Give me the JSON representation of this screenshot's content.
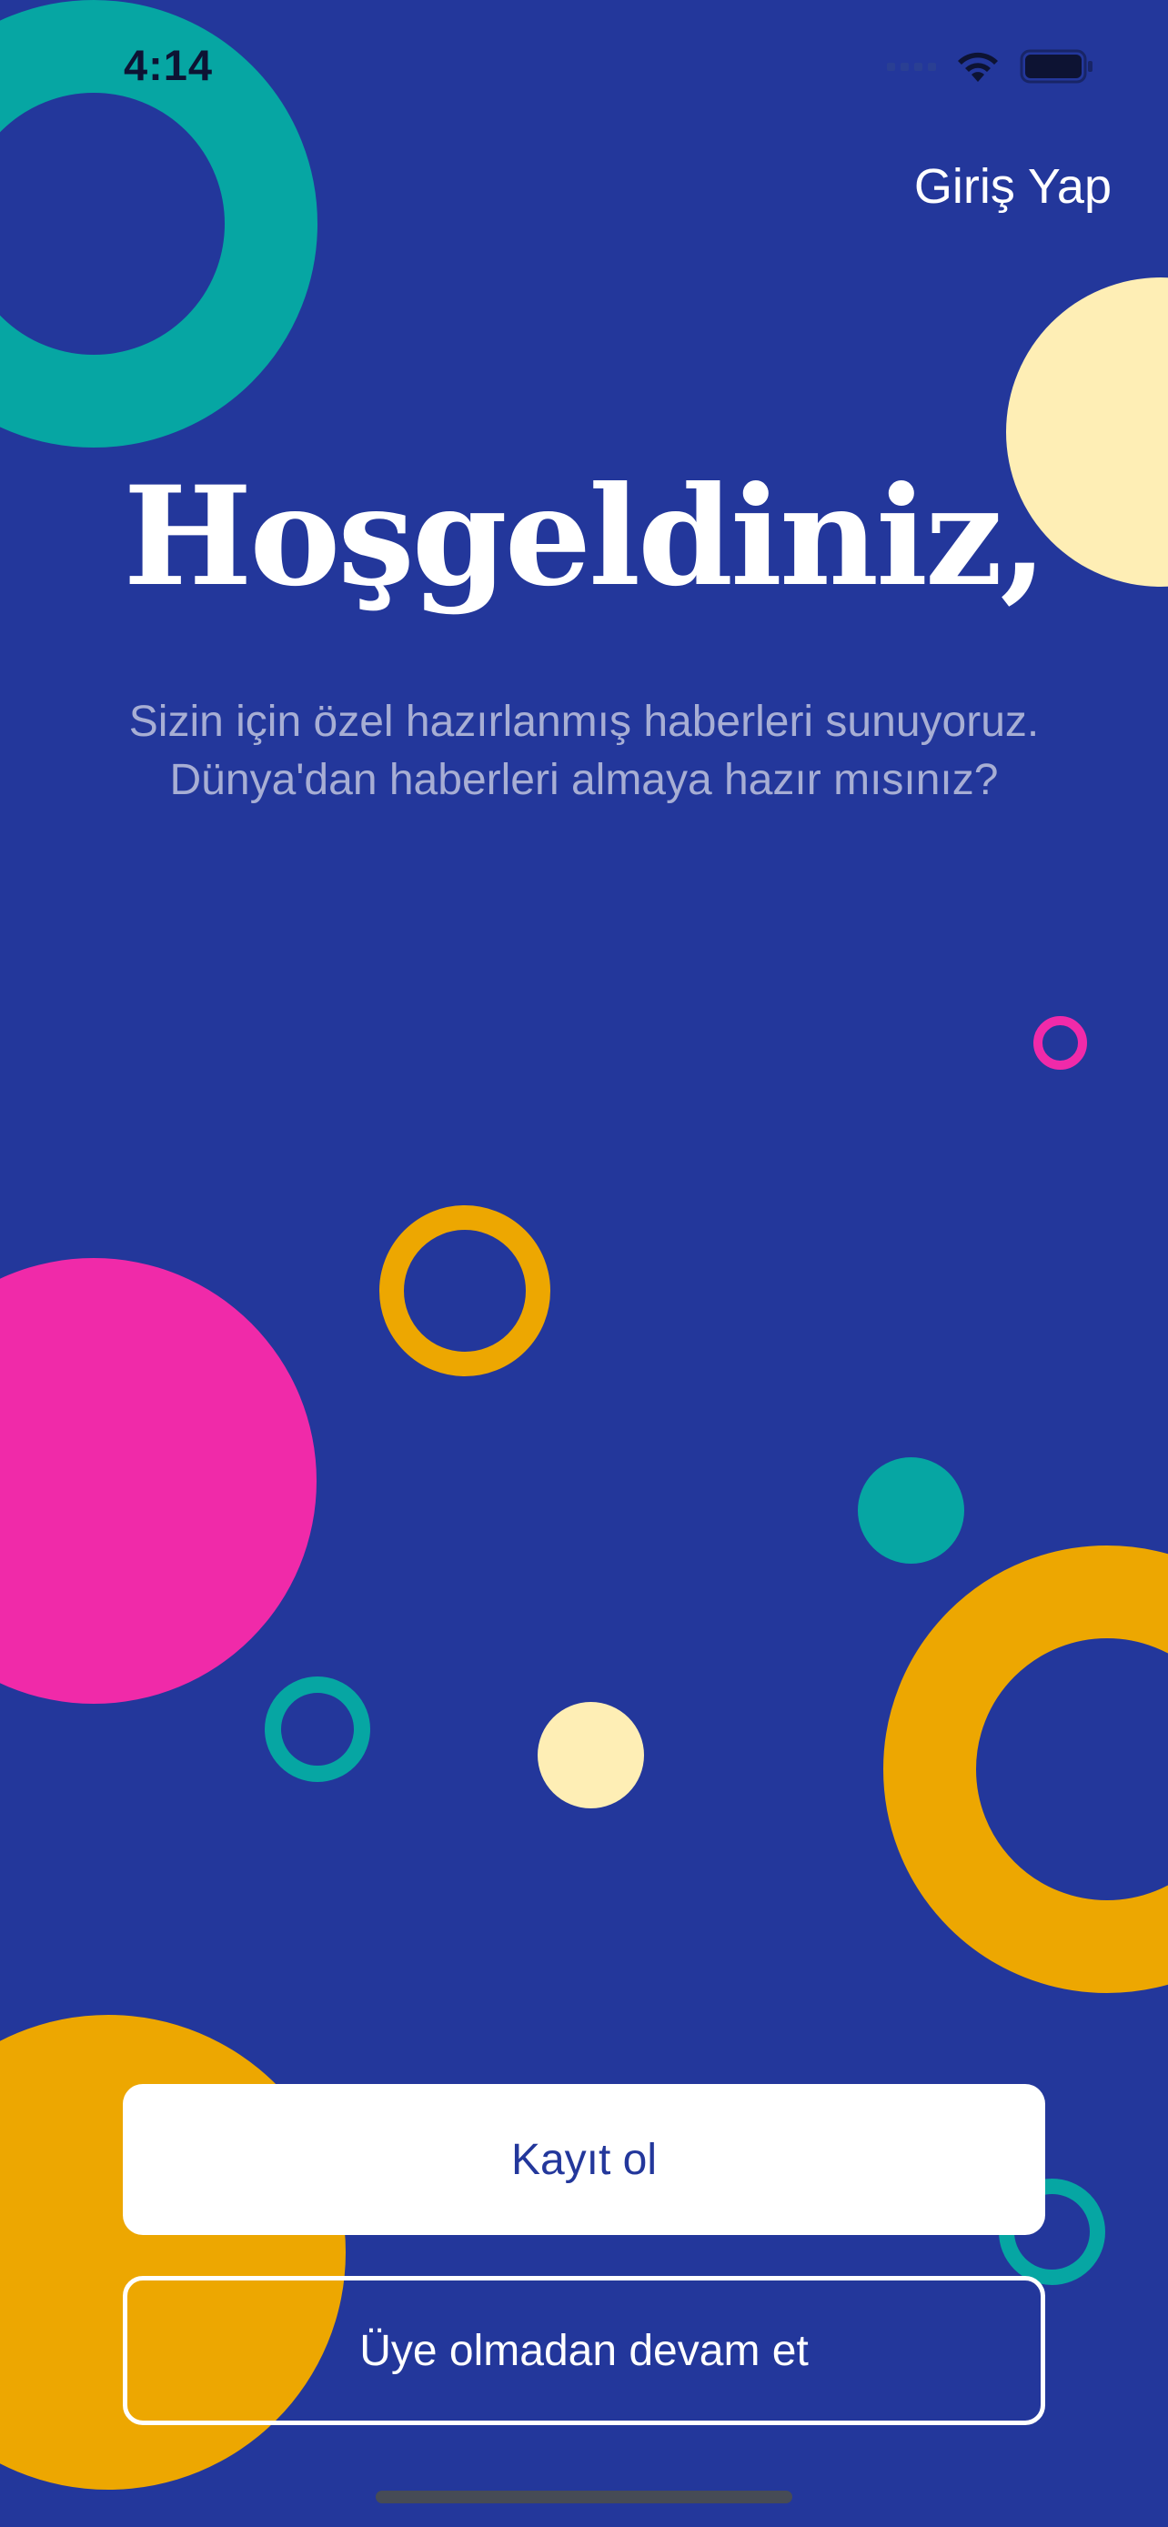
{
  "status_bar": {
    "time": "4:14"
  },
  "header": {
    "login_label": "Giriş Yap"
  },
  "welcome": {
    "title": "Hoşgeldiniz,",
    "subtitle_line1": "Sizin için özel hazırlanmış haberleri sunuyoruz.",
    "subtitle_line2": "Dünya'dan haberleri almaya hazır mısınız?"
  },
  "actions": {
    "register_label": "Kayıt ol",
    "guest_label": "Üye olmadan devam et"
  },
  "colors": {
    "background": "#23379b",
    "teal": "#06a6a3",
    "cream": "#feeeb5",
    "pink": "#f02aa9",
    "orange": "#eda701",
    "subtitle_text": "#a7aed4"
  },
  "icons": [
    "signal-icon",
    "wifi-icon",
    "battery-icon"
  ]
}
